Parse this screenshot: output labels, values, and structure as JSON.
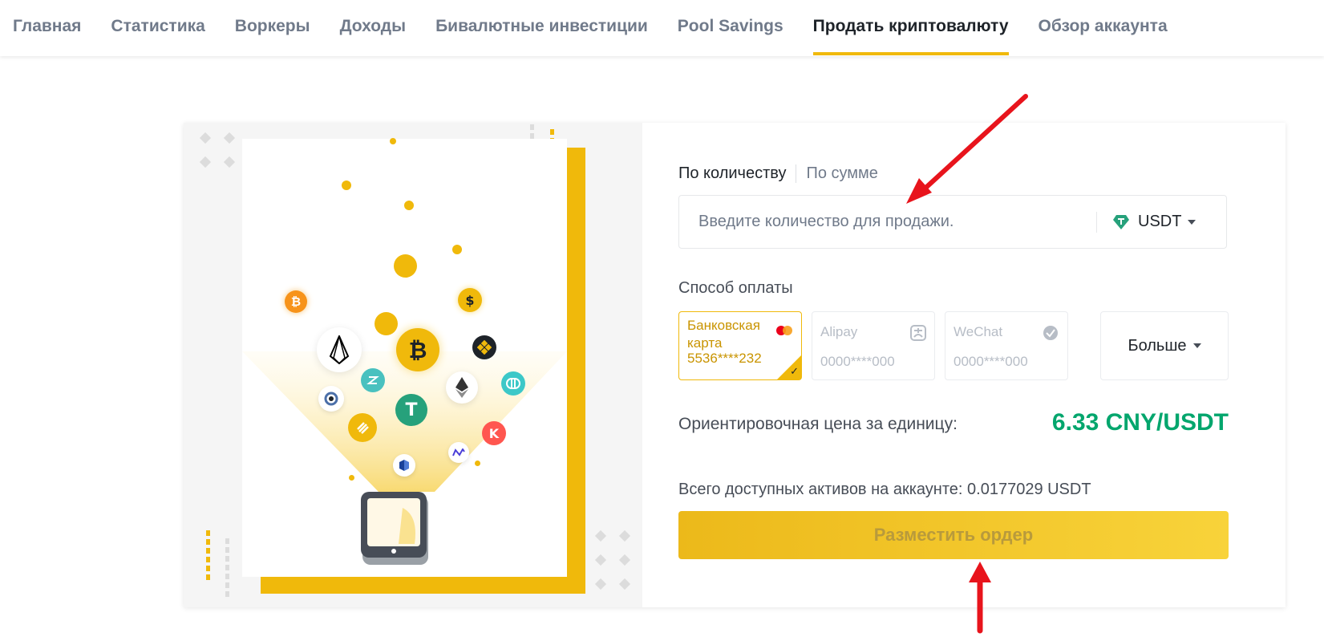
{
  "nav": {
    "items": [
      {
        "label": "Главная",
        "active": false
      },
      {
        "label": "Статистика",
        "active": false
      },
      {
        "label": "Воркеры",
        "active": false
      },
      {
        "label": "Доходы",
        "active": false
      },
      {
        "label": "Бивалютные инвестиции",
        "active": false
      },
      {
        "label": "Pool Savings",
        "active": false
      },
      {
        "label": "Продать криптовалюту",
        "active": true
      },
      {
        "label": "Обзор аккаунта",
        "active": false
      }
    ]
  },
  "form": {
    "tabs": {
      "by_quantity": "По количеству",
      "by_amount": "По сумме"
    },
    "quantity_placeholder": "Введите количество для продажи.",
    "asset": {
      "label": "USDT",
      "icon": "usdt-diamond-icon",
      "color": "#26a17b"
    },
    "payment_label": "Способ оплаты",
    "payment_methods": [
      {
        "name": "Банковская карта",
        "number": "5536****232",
        "icon": "mastercard-icon",
        "selected": true
      },
      {
        "name": "Alipay",
        "number": "0000****000",
        "icon": "alipay-icon",
        "selected": false
      },
      {
        "name": "WeChat",
        "number": "0000****000",
        "icon": "wechat-icon",
        "selected": false
      }
    ],
    "more_label": "Больше",
    "price_label": "Ориентировочная цена за единицу:",
    "price_value": "6.33 CNY/USDT",
    "available_text": "Всего доступных активов на аккаунте: 0.0177029 USDT",
    "submit_label": "Разместить ордер"
  },
  "illustration": {
    "coin_symbols": {
      "bitcoin": "₿",
      "dollar": "$",
      "kava": "K",
      "tether": "T"
    }
  },
  "colors": {
    "accent": "#f0b90b",
    "price": "#03a66d",
    "annotation_arrow": "#e8141c"
  }
}
